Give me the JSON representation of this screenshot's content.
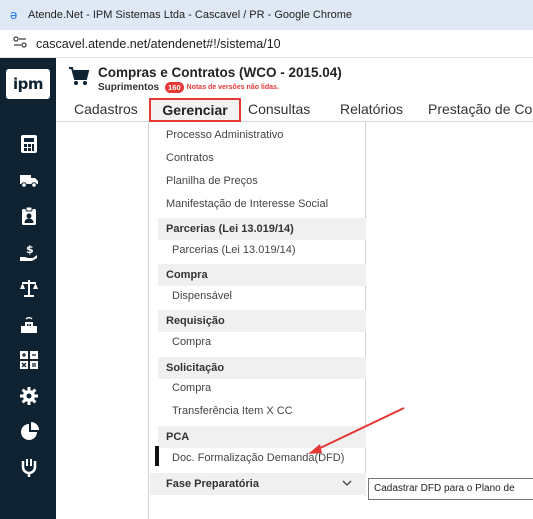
{
  "browser": {
    "window_title": "Atende.Net - IPM Sistemas Ltda - Cascavel / PR - Google Chrome",
    "url": "cascavel.atende.net/atendenet#!/sistema/10"
  },
  "app": {
    "logo_text": "ipm",
    "title": "Compras e Contratos (WCO - 2015.04)",
    "module": "Suprimentos",
    "notes_count": "160",
    "notes_label": "Notas de versões não lidas."
  },
  "menu": {
    "items": [
      "Cadastros",
      "Gerenciar",
      "Consultas",
      "Relatórios",
      "Prestação de Co"
    ]
  },
  "dropdown": {
    "items": [
      "Processo Administrativo",
      "Contratos",
      "Planilha de Preços",
      "Manifestação de Interesse Social"
    ],
    "groups": [
      {
        "title": "Parcerias (Lei 13.019/14)",
        "items": [
          "Parcerias (Lei 13.019/14)"
        ]
      },
      {
        "title": "Compra",
        "items": [
          "Dispensável"
        ]
      },
      {
        "title": "Requisição",
        "items": [
          "Compra"
        ]
      },
      {
        "title": "Solicitação",
        "items": [
          "Compra",
          "Transferência Item X CC"
        ]
      },
      {
        "title": "PCA",
        "items": [
          "Doc. Formalização Demanda(DFD)"
        ]
      }
    ],
    "footer_group": "Fase Preparatória"
  },
  "tooltip": "Cadastrar DFD para o Plano de",
  "colors": {
    "highlight": "#e53935",
    "sidebar": "#0f2232"
  }
}
